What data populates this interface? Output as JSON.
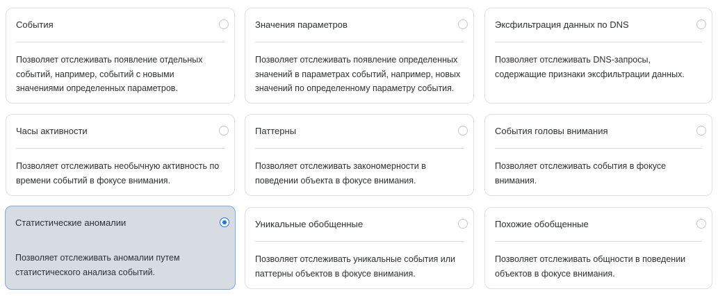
{
  "cards": [
    {
      "title": "События",
      "description": "Позволяет отслеживать появление отдельных событий, например, событий с новыми значениями определенных параметров.",
      "selected": false
    },
    {
      "title": "Значения параметров",
      "description": "Позволяет отслеживать появление определенных значений в параметрах событий, например, новых значений по определенному параметру события.",
      "selected": false
    },
    {
      "title": "Эксфильтрация данных по DNS",
      "description": "Позволяет отслеживать DNS-запросы, содержащие признаки эксфильтрации данных.",
      "selected": false
    },
    {
      "title": "Часы активности",
      "description": "Позволяет отслеживать необычную активность по времени событий в фокусе внимания.",
      "selected": false
    },
    {
      "title": "Паттерны",
      "description": "Позволяет отслеживать закономерности в поведении объекта в фокусе внимания.",
      "selected": false
    },
    {
      "title": "События головы внимания",
      "description": "Позволяет отслеживать события в фокусе внимания.",
      "selected": false
    },
    {
      "title": "Статистические аномалии",
      "description": "Позволяет отслеживать аномалии путем статистического анализа событий.",
      "selected": true
    },
    {
      "title": "Уникальные обобщенные",
      "description": "Позволяет отслеживать уникальные события или паттерны объектов в фокусе внимания.",
      "selected": false
    },
    {
      "title": "Похожие обобщенные",
      "description": "Позволяет отслеживать общности в поведении объектов в фокусе внимания.",
      "selected": false
    }
  ],
  "colors": {
    "selected_background": "#d7dbe2",
    "selected_border": "#7aa6ec",
    "radio_accent": "#1f74e8"
  }
}
